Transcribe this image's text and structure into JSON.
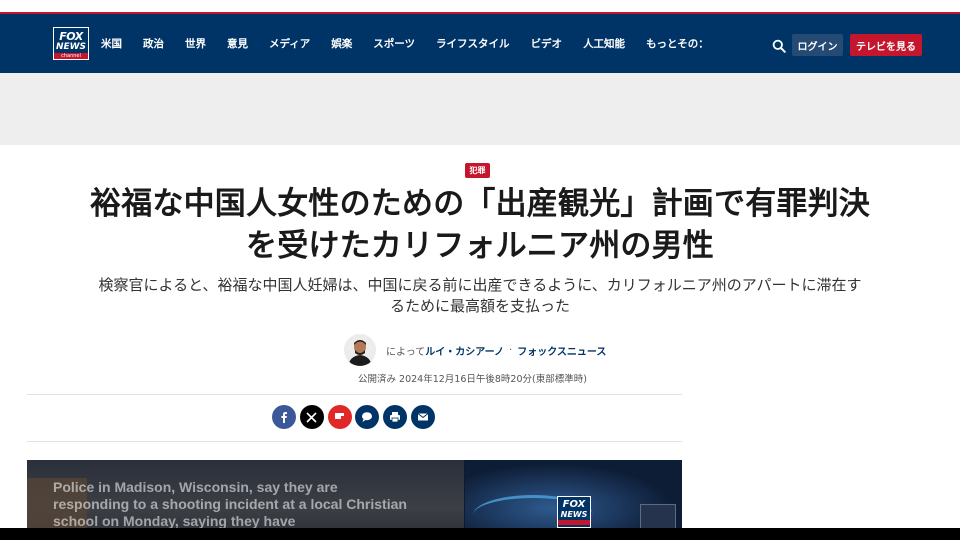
{
  "header": {
    "logo": {
      "line1": "FOX",
      "line2": "NEWS",
      "line3": "channel"
    },
    "nav": [
      "米国",
      "政治",
      "世界",
      "意見",
      "メディア",
      "娯楽",
      "スポーツ",
      "ライフスタイル",
      "ビデオ",
      "人工知能",
      "もっとその："
    ],
    "login_label": "ログイン",
    "tv_label": "テレビを見る"
  },
  "article": {
    "category": "犯罪",
    "headline_line1": "裕福な中国人女性のための「出産観光」計画で有罪判決",
    "headline_line2": "を受けたカリフォルニア州の男性",
    "subhead_line1": "検察官によると、裕福な中国人妊婦は、中国に戻る前に出産できるように、カリフォルニア州のアパートに滞在す",
    "subhead_line2": "るために最高額を支払った",
    "byline_prefix": "によって",
    "author": "ルイ・カシアーノ",
    "separator": "·",
    "organization": "フォックスニュース",
    "published": "公開済み 2024年12月16日午後8時20分(東部標準時)"
  },
  "share": {
    "icons": [
      "facebook-icon",
      "x-icon",
      "flipboard-icon",
      "comment-icon",
      "print-icon",
      "email-icon"
    ]
  },
  "video": {
    "caption": "Police in Madison, Wisconsin, say they are responding to a shooting incident at a local Christian school on Monday, saying they have",
    "logo": {
      "line1": "FOX",
      "line2": "NEWS"
    }
  },
  "colors": {
    "header_bg": "#003366",
    "accent_red": "#c4162d",
    "login_bg": "#254a73",
    "facebook": "#3b5998",
    "x": "#000000",
    "flipboard": "#e12828",
    "comment": "#003366",
    "print": "#003366",
    "email": "#003366"
  }
}
